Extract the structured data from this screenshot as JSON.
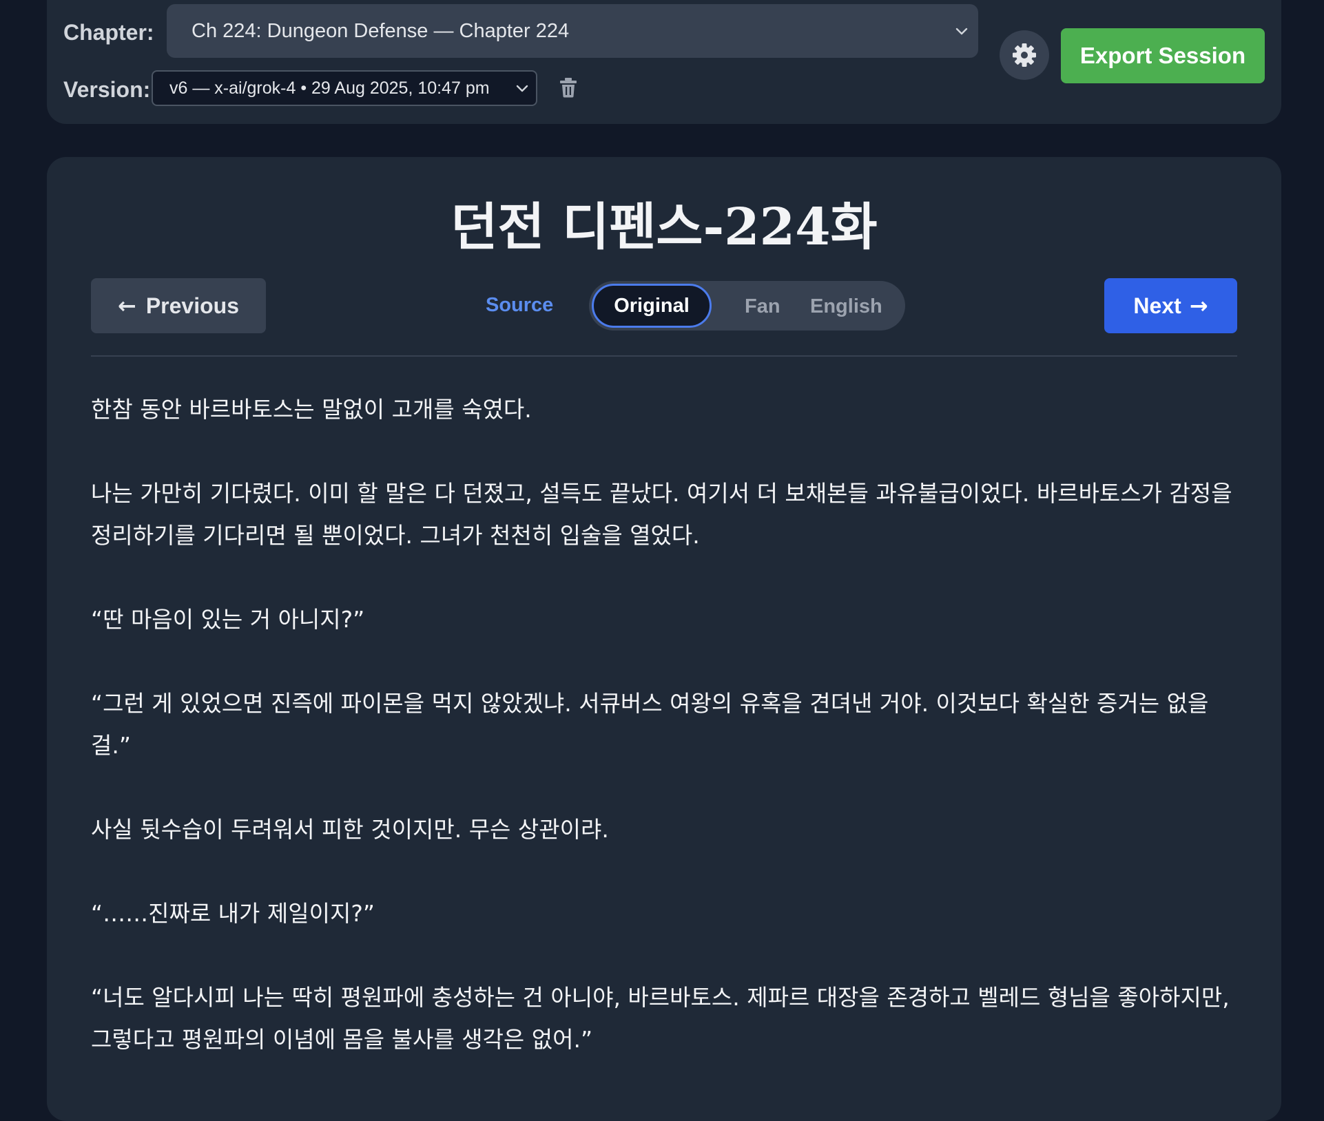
{
  "toolbar": {
    "chapter_label": "Chapter:",
    "chapter_value": "Ch 224: Dungeon Defense — Chapter 224",
    "version_label": "Version:",
    "version_value": "v6 — x-ai/grok-4 • 29 Aug 2025, 10:47 pm",
    "export_label": "Export Session",
    "icons": [
      "chevron-down-icon",
      "trash-icon",
      "gear-icon"
    ]
  },
  "reader": {
    "title": "던전 디펜스-224화",
    "prev_label": "Previous",
    "next_label": "Next",
    "tabs": {
      "source": "Source",
      "original": "Original",
      "fan": "Fan",
      "english": "English",
      "active": "Original"
    },
    "paragraphs": [
      "한참 동안 바르바토스는 말없이 고개를 숙였다.",
      "나는 가만히 기다렸다. 이미 할 말은 다 던졌고, 설득도 끝났다. 여기서 더 보채본들 과유불급이었다. 바르바토스가 감정을 정리하기를 기다리면 될 뿐이었다. 그녀가 천천히 입술을 열었다.",
      "“딴 마음이 있는 거 아니지?”",
      "“그런 게 있었으면 진즉에 파이몬을 먹지 않았겠냐. 서큐버스 여왕의 유혹을 견뎌낸 거야. 이것보다 확실한 증거는 없을 걸.”",
      "사실 뒷수습이 두려워서 피한 것이지만. 무슨 상관이랴.",
      "“……진짜로 내가 제일이지?”",
      "“너도 알다시피 나는 딱히 평원파에 충성하는 건 아니야, 바르바토스. 제파르 대장을 존경하고 벨레드 형님을 좋아하지만, 그렇다고 평원파의 이념에 몸을 불사를 생각은 없어.”"
    ]
  },
  "colors": {
    "page_bg": "#111827",
    "card_bg": "#1f2937",
    "export_green": "#4caf50",
    "next_blue": "#2f60e6",
    "source_link": "#5b8def",
    "active_tab_border": "#4b7bec"
  }
}
